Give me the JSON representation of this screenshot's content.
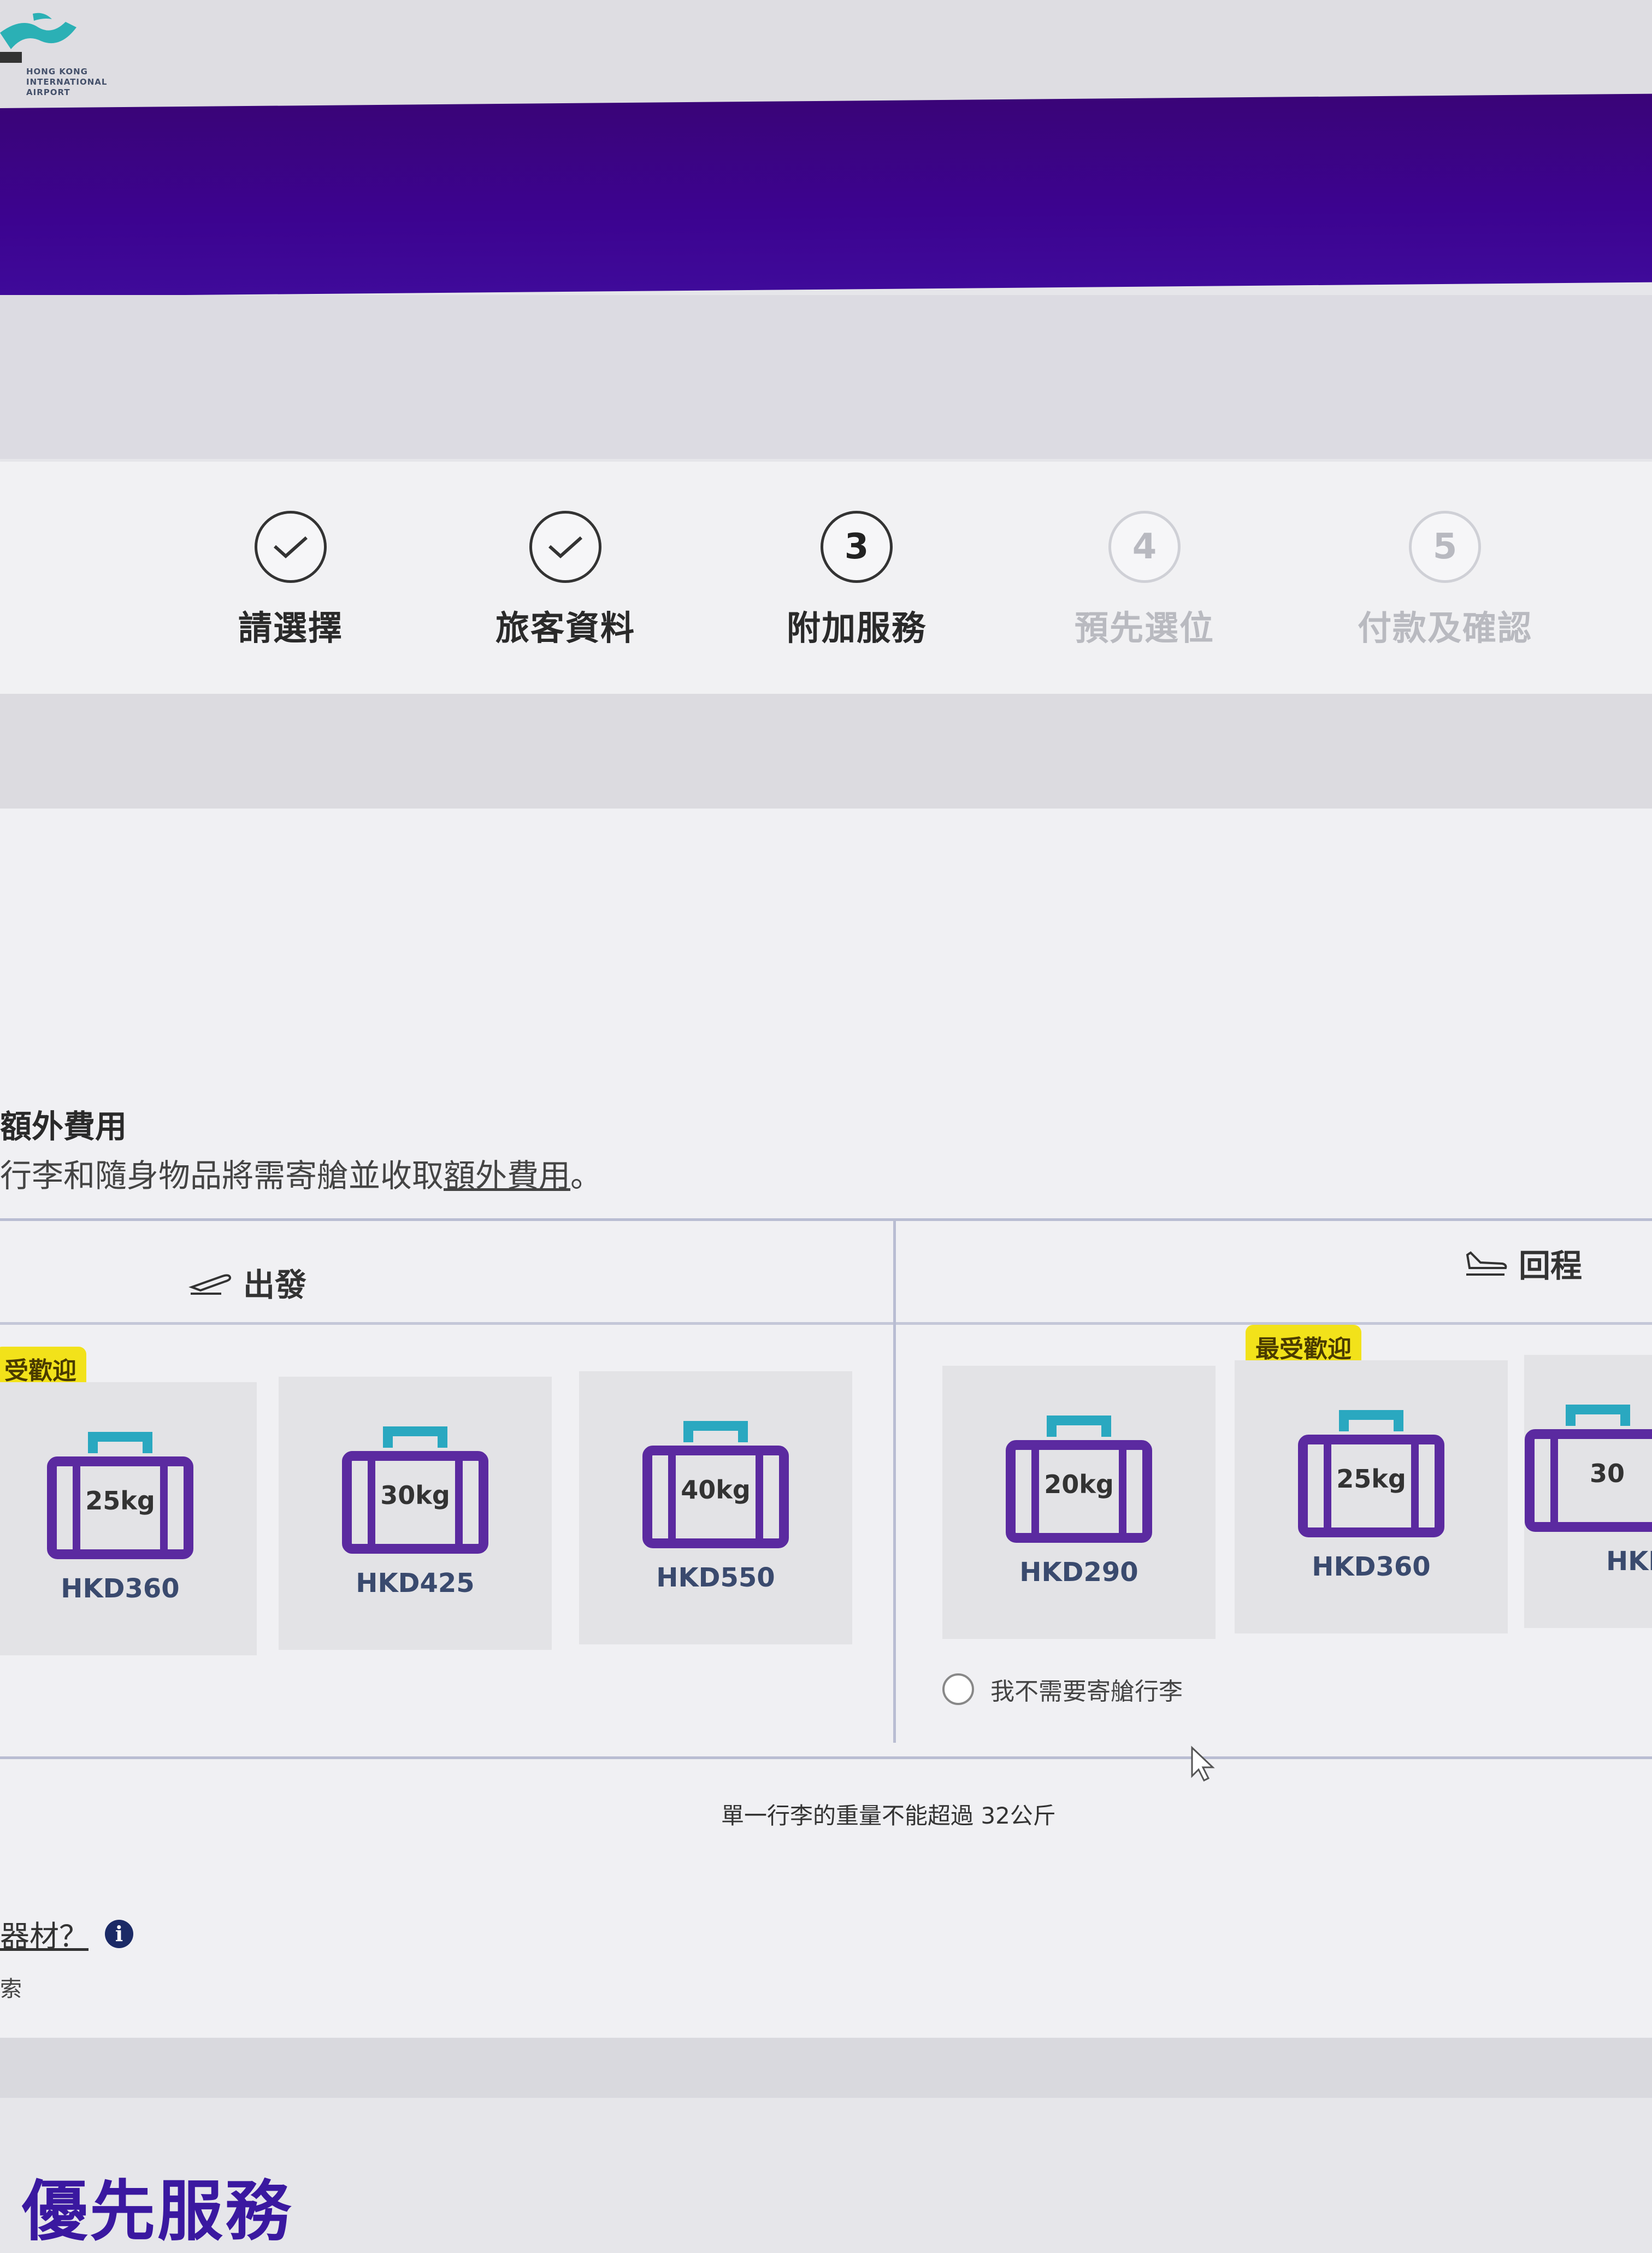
{
  "logo": {
    "text": "HONG KONG INTERNATIONAL AIRPORT",
    "icon": "airport-logo-icon"
  },
  "steps": [
    {
      "label": "請選擇",
      "status": "done",
      "icon": "check-icon"
    },
    {
      "label": "旅客資料",
      "status": "done",
      "icon": "check-icon"
    },
    {
      "label": "附加服務",
      "status": "current",
      "number": "3"
    },
    {
      "label": "預先選位",
      "status": "pending",
      "number": "4"
    },
    {
      "label": "付款及確認",
      "status": "pending",
      "number": "5"
    }
  ],
  "baggage": {
    "title": "額外費用",
    "desc_prefix": "行李和隨身物品將需寄艙並收取",
    "desc_link": "額外費用",
    "desc_suffix": "。",
    "departure": {
      "label": "出發",
      "icon": "plane-takeoff-icon",
      "badge": "受歡迎",
      "options": [
        {
          "kg": "25kg",
          "price": "HKD360"
        },
        {
          "kg": "30kg",
          "price": "HKD425"
        },
        {
          "kg": "40kg",
          "price": "HKD550"
        }
      ]
    },
    "return": {
      "label": "回程",
      "icon": "plane-landing-icon",
      "badge": "最受歡迎",
      "options": [
        {
          "kg": "20kg",
          "price": "HKD290"
        },
        {
          "kg": "25kg",
          "price": "HKD360"
        },
        {
          "kg": "30",
          "price": "HKI"
        }
      ],
      "no_bag_label": "我不需要寄艙行李"
    },
    "limit_note": "單一行李的重量不能超過 32公斤"
  },
  "equipment": {
    "question": "器材？",
    "sub": "索",
    "icon": "info-icon"
  },
  "next_section": {
    "title": "優先服務"
  },
  "colors": {
    "banner": "#3c0390",
    "badge": "#f2e21a",
    "bag_body": "#5b2aa0",
    "bag_handle": "#2aa8c0"
  }
}
